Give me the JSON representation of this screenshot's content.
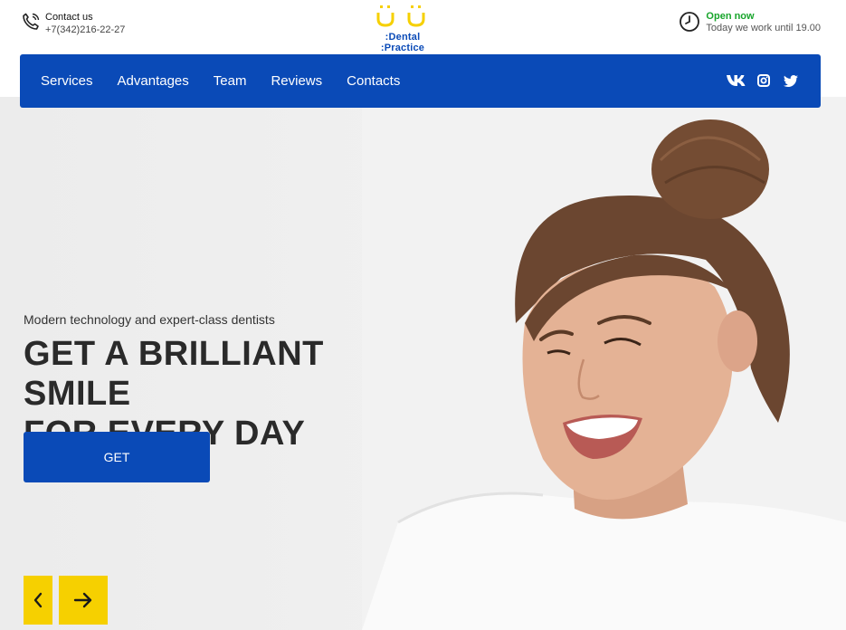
{
  "header": {
    "contact": {
      "label": "Contact us",
      "phone": "+7(342)216-22-27",
      "icon": "phone-icon"
    },
    "logo": {
      "name": ":Dental :Practice",
      "icon": "smile-logo-icon"
    },
    "hours": {
      "status": "Open now",
      "detail": "Today we work until 19.00",
      "icon": "clock-icon"
    }
  },
  "nav": {
    "items": [
      {
        "label": "Services"
      },
      {
        "label": "Advantages"
      },
      {
        "label": "Team"
      },
      {
        "label": "Reviews"
      },
      {
        "label": "Contacts"
      }
    ],
    "social": [
      "vk-icon",
      "instagram-icon",
      "twitter-icon"
    ]
  },
  "hero": {
    "subtitle": "Modern technology and expert-class dentists",
    "headline_line1": "GET A BRILLIANT SMILE",
    "headline_line2": "FOR EVERY DAY",
    "cta": "GET",
    "prev_icon": "chevron-left-icon",
    "next_icon": "arrow-right-icon"
  },
  "colors": {
    "brand_blue": "#0a4ab7",
    "accent_yellow": "#f6d000",
    "open_green": "#17a52b"
  }
}
